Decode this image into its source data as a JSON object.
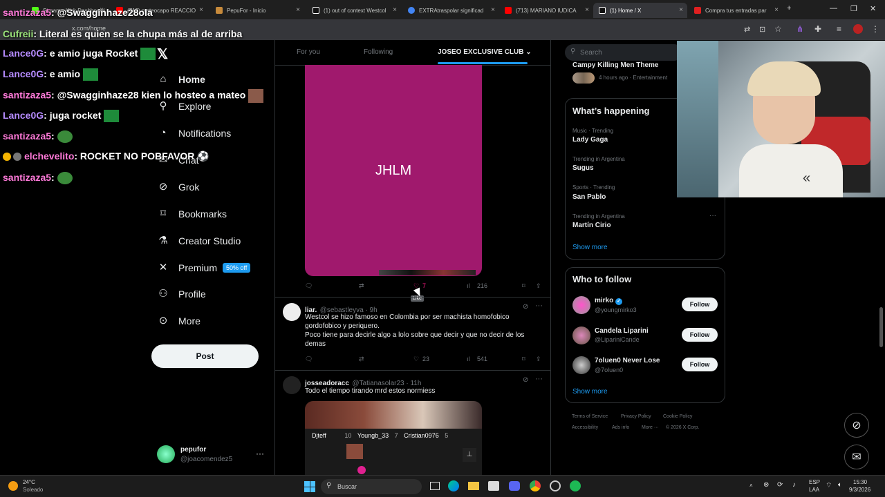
{
  "browser": {
    "tabs": [
      {
        "label": "Stream - Kick Dashboard",
        "color": "#53fc18"
      },
      {
        "label": "(712) mateocapo REACCIO",
        "color": "#ff0000"
      },
      {
        "label": "PepuFor - Inicio",
        "color": "#c78a3b"
      },
      {
        "label": "(1) out of context Westcol",
        "color": "#ffffff"
      },
      {
        "label": "EXTRAtraspolar significad",
        "color": "#4285f4"
      },
      {
        "label": "(713) MARIANO IUDICA",
        "color": "#ff0000"
      },
      {
        "label": "(1) Home / X",
        "color": "#ffffff"
      },
      {
        "label": "Compra tus entradas par",
        "color": "#e02020"
      }
    ],
    "url": "x.com/home"
  },
  "sidebar": {
    "items": [
      {
        "label": "Home",
        "icon": "home-icon",
        "glyph": "⌂"
      },
      {
        "label": "Explore",
        "icon": "search-icon",
        "glyph": "⚲"
      },
      {
        "label": "Notifications",
        "icon": "bell-icon",
        "glyph": "🔔"
      },
      {
        "label": "Chat",
        "icon": "mail-icon",
        "glyph": "✉"
      },
      {
        "label": "Grok",
        "icon": "grok-icon",
        "glyph": "⊘"
      },
      {
        "label": "Bookmarks",
        "icon": "bookmark-icon",
        "glyph": "🔖"
      },
      {
        "label": "Creator Studio",
        "icon": "flask-icon",
        "glyph": "⚗"
      },
      {
        "label": "Premium",
        "icon": "x-logo-icon",
        "glyph": "𝕏"
      },
      {
        "label": "Profile",
        "icon": "person-icon",
        "glyph": "👤"
      },
      {
        "label": "More",
        "icon": "more-circle-icon",
        "glyph": "⋯"
      }
    ],
    "premium_badge": "50% off",
    "post_label": "Post",
    "account": {
      "name": "pepufor",
      "handle": "@joacomendez5"
    }
  },
  "timeline": {
    "tabs": [
      "For you",
      "Following",
      "JOSEO EXCLUSIVE CLUB"
    ],
    "image_text": "JHLM",
    "tweet1_actions": {
      "likes": "7",
      "views": "216",
      "tooltip": "Like"
    },
    "tweet2": {
      "name": "liar.",
      "handle": "@sebastleyva · 9h",
      "text": "Westcol se hizo famoso en Colombia por ser machista homofobico gordofobico y periquero.\nPoco tiene para decirle algo a lolo sobre que decir y que no decir de los demas",
      "likes": "23",
      "views": "541"
    },
    "tweet3": {
      "name": "josseadoracc",
      "handle": "@Tatianasolar23 · 11h",
      "text": "Todo el tiempo tirando mrd estos normiess",
      "overlay_names": [
        "Djteff",
        "10",
        "Youngb_33",
        "7",
        "Cristian0976",
        "5"
      ]
    }
  },
  "right": {
    "search_placeholder": "Search",
    "top_trend": {
      "title": "Campy  Killing Men  Theme",
      "meta": "4 hours ago · Entertainment"
    },
    "whats_happening": "What’s happening",
    "trends": [
      {
        "context": "Music · Trending",
        "name": "Lady Gaga"
      },
      {
        "context": "Trending in Argentina",
        "name": "Sugus"
      },
      {
        "context": "Sports · Trending",
        "name": "San Pablo"
      },
      {
        "context": "Trending in Argentina",
        "name": "Martín Cirio"
      }
    ],
    "show_more": "Show more",
    "who_to_follow": "Who to follow",
    "follow": [
      {
        "name": "mirko",
        "handle": "@youngmirko3",
        "verified": true
      },
      {
        "name": "Candela Liparini",
        "handle": "@LipariniCande",
        "verified": false
      },
      {
        "name": "7oluen0 Never Lose",
        "handle": "@7oluen0",
        "verified": false
      }
    ],
    "follow_label": "Follow",
    "footer": [
      "Terms of Service",
      "Privacy Policy",
      "Cookie Policy",
      "Accessibility",
      "Ads info",
      "More ···",
      "© 2026 X Corp."
    ]
  },
  "chat": [
    {
      "user": "santizaza5",
      "color": "#ff7ad9",
      "msg": ": @Swagginhaze28ola"
    },
    {
      "user": "Cufreii",
      "color": "#9be37a",
      "msg": ": Literal es quien se la chupa más al de arriba"
    },
    {
      "user": "Lance0G",
      "color": "#b68cff",
      "msg": ": e amio juga Rocket"
    },
    {
      "user": "Lance0G",
      "color": "#b68cff",
      "msg": ": e amio"
    },
    {
      "user": "santizaza5",
      "color": "#ff7ad9",
      "msg": ": @Swagginhaze28 kien lo hosteo a mateo"
    },
    {
      "user": "Lance0G",
      "color": "#b68cff",
      "msg": ": juga rocket"
    },
    {
      "user": "santizaza5",
      "color": "#ff7ad9",
      "msg": ":"
    },
    {
      "user": "elchevelito",
      "color": "#ff7ad9",
      "msg": ": ROCKET NO POBFAVOR"
    },
    {
      "user": "santizaza5",
      "color": "#ff7ad9",
      "msg": ":"
    }
  ],
  "taskbar": {
    "weather_temp": "24°C",
    "weather_desc": "Soleado",
    "search_placeholder": "Buscar",
    "lang": "ESP",
    "lang2": "LAA",
    "time": "15:30",
    "date": "9/3/2026"
  },
  "colors": {
    "accent": "#1d9bf0",
    "purple_image": "#a0196d"
  }
}
